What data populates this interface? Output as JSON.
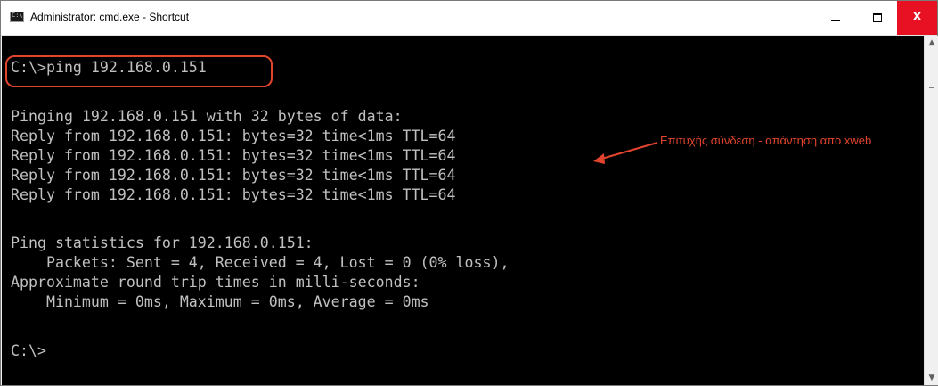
{
  "window": {
    "title": "Administrator: cmd.exe - Shortcut",
    "minimize_label": "–",
    "maximize_label": "□",
    "close_label": "x"
  },
  "console": {
    "lines": [
      "C:\\>ping 192.168.0.151",
      "",
      "Pinging 192.168.0.151 with 32 bytes of data:",
      "Reply from 192.168.0.151: bytes=32 time<1ms TTL=64",
      "Reply from 192.168.0.151: bytes=32 time<1ms TTL=64",
      "Reply from 192.168.0.151: bytes=32 time<1ms TTL=64",
      "Reply from 192.168.0.151: bytes=32 time<1ms TTL=64",
      "",
      "Ping statistics for 192.168.0.151:",
      "    Packets: Sent = 4, Received = 4, Lost = 0 (0% loss),",
      "Approximate round trip times in milli-seconds:",
      "    Minimum = 0ms, Maximum = 0ms, Average = 0ms",
      "",
      "C:\\>"
    ]
  },
  "annotation": {
    "text": "Επιτυχής σύνδεση - απάντηση απο xweb",
    "color": "#e0442d"
  },
  "scrollbar": {
    "up_icon": "▲",
    "down_icon": "▼"
  }
}
